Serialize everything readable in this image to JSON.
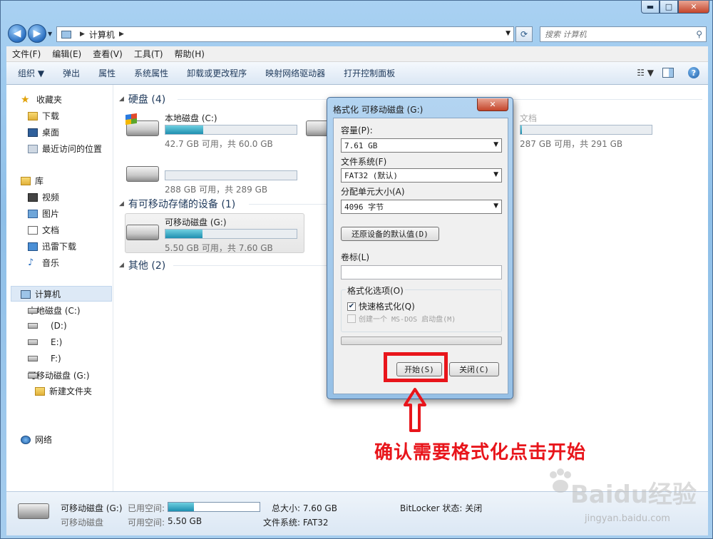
{
  "window": {
    "minimize": "▬",
    "maximize": "□",
    "close": "✕"
  },
  "address": {
    "path": "计算机",
    "search_placeholder": "搜索 计算机"
  },
  "menu": [
    "文件(F)",
    "编辑(E)",
    "查看(V)",
    "工具(T)",
    "帮助(H)"
  ],
  "commands": [
    "组织 ▼",
    "弹出",
    "属性",
    "系统属性",
    "卸载或更改程序",
    "映射网络驱动器",
    "打开控制面板"
  ],
  "nav": {
    "favorites": "收藏夹",
    "downloads": "下载",
    "desktop": "桌面",
    "recent": "最近访问的位置",
    "libraries": "库",
    "videos": "视频",
    "pictures": "图片",
    "documents": "文档",
    "thunder": "迅雷下载",
    "music": "音乐",
    "computer": "计算机",
    "drive_c": "本地磁盘 (C:)",
    "drive_d": "(D:)",
    "drive_e": "E:)",
    "drive_f": "F:)",
    "drive_g": "可移动磁盘 (G:)",
    "new_folder": "新建文件夹",
    "network": "网络"
  },
  "groups": {
    "hard_disks": "硬盘 (4)",
    "removable": "有可移动存储的设备 (1)",
    "other": "其他 (2)"
  },
  "drives": [
    {
      "name": "本地磁盘 (C:)",
      "info": "42.7 GB 可用，共 60.0 GB",
      "used_fraction": 0.29
    },
    {
      "name": "文档",
      "info": "287 GB 可用，共 291 GB",
      "used_fraction": 0.01
    },
    {
      "name": "",
      "info": "288 GB 可用，共 289 GB",
      "used_fraction": 0.0
    },
    {
      "name": "可移动磁盘 (G:)",
      "info": "5.50 GB 可用，共 7.60 GB",
      "used_fraction": 0.28
    }
  ],
  "details": {
    "name": "可移动磁盘 (G:)",
    "type": "可移动磁盘",
    "used_label": "已用空间:",
    "free_label": "可用空间:",
    "free_value": "5.50 GB",
    "total": "总大小: 7.60 GB",
    "fs": "文件系统: FAT32",
    "bitlocker": "BitLocker 状态: 关闭",
    "used_fraction": 0.28
  },
  "dialog": {
    "title": "格式化 可移动磁盘 (G:)",
    "close": "✕",
    "capacity_label": "容量(P):",
    "capacity_value": "7.61 GB",
    "fs_label": "文件系统(F)",
    "fs_value": "FAT32 (默认)",
    "alloc_label": "分配单元大小(A)",
    "alloc_value": "4096 字节",
    "restore_button": "还原设备的默认值(D)",
    "volume_label": "卷标(L)",
    "volume_value": "",
    "options_legend": "格式化选项(O)",
    "quick_format": "快速格式化(Q)",
    "msdos": "创建一个 MS-DOS 启动盘(M)",
    "start_button": "开始(S)",
    "close_button": "关闭(C)"
  },
  "annotation": {
    "text": "确认需要格式化点击开始",
    "color": "#e8151b"
  },
  "watermark": {
    "text": "Baidu经验",
    "sub": "jingyan.baidu.com"
  }
}
